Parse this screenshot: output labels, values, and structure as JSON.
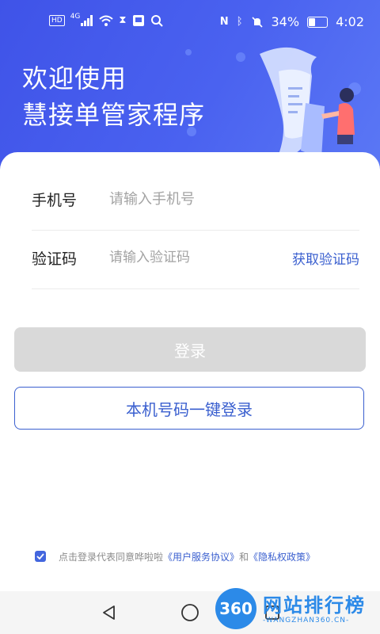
{
  "status_bar": {
    "hd": "HD",
    "network": "4G",
    "battery_percent": "34%",
    "time": "4:02"
  },
  "header": {
    "line1": "欢迎使用",
    "line2": "慧接单管家程序"
  },
  "form": {
    "phone": {
      "label": "手机号",
      "placeholder": "请输入手机号"
    },
    "code": {
      "label": "验证码",
      "placeholder": "请输入验证码",
      "get_code": "获取验证码"
    }
  },
  "buttons": {
    "login": "登录",
    "one_key_login": "本机号码一键登录"
  },
  "agreement": {
    "checked": true,
    "prefix": "点击登录代表同意哗啦啦",
    "user_agreement": "《用户服务协议》",
    "and": "和",
    "privacy_policy": "《隐私权政策》"
  },
  "watermark": {
    "logo_number": "360",
    "title": "网站排行榜",
    "subtitle": "-WANGZHAN360.CN-"
  },
  "colors": {
    "header_blue": "#4a62f0",
    "accent_blue": "#3a5fcf",
    "disabled_button": "#d9d9d9"
  }
}
